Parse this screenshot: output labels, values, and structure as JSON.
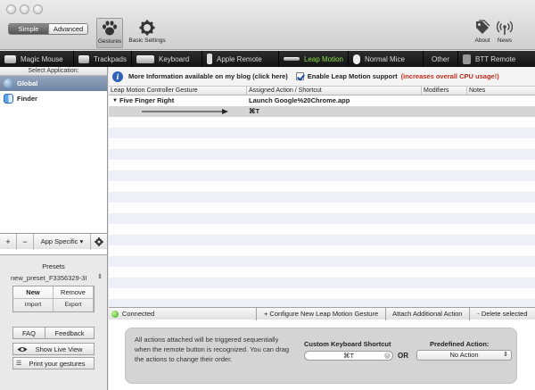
{
  "toolbar": {
    "mode_simple": "Simple",
    "mode_advanced": "Advanced",
    "gestures_label": "Gestures",
    "basic_settings_label": "Basic Settings",
    "about_label": "About",
    "news_label": "News"
  },
  "devices": [
    {
      "label": "Magic Mouse",
      "icon": "magic-mouse-icon"
    },
    {
      "label": "Trackpads",
      "icon": "trackpad-icon"
    },
    {
      "label": "Keyboard",
      "icon": "keyboard-icon"
    },
    {
      "label": "Apple Remote",
      "icon": "apple-remote-icon"
    },
    {
      "label": "Leap Motion",
      "icon": "leap-motion-icon",
      "active": true
    },
    {
      "label": "Normal Mice",
      "icon": "mouse-icon"
    },
    {
      "label": "Other",
      "icon": ""
    },
    {
      "label": "BTT Remote",
      "icon": "btt-remote-icon"
    }
  ],
  "sidebar": {
    "header": "Select Application:",
    "apps": [
      {
        "label": "Global",
        "icon": "globe-icon",
        "selected": true
      },
      {
        "label": "Finder",
        "icon": "finder-icon"
      }
    ],
    "add": "+",
    "remove": "−",
    "app_specific": "App Specific ▾",
    "settings_icon": "gear-icon"
  },
  "presets": {
    "label": "Presets",
    "current": "new_preset_F3356329-3I",
    "new": "New",
    "remove": "Remove",
    "import": "Import",
    "export": "Export",
    "faq": "FAQ",
    "feedback": "Feedback",
    "show_live_view": "Show Live View",
    "print_gestures": "Print your gestures"
  },
  "infobar": {
    "blog_link": "More Information available on my blog (click here)",
    "enable_label": "Enable Leap Motion support",
    "warning": "(increases overall CPU usage!)",
    "enabled": true
  },
  "table": {
    "columns": [
      "Leap Motion Controller Gesture",
      "Assigned Action / Shortcut",
      "Modifiers",
      "Notes"
    ],
    "rows": [
      {
        "gesture": "Five Finger Right",
        "action": "Launch Google%20Chrome.app",
        "modifiers": "",
        "notes": ""
      },
      {
        "gesture": "",
        "action": "⌘T",
        "modifiers": "",
        "notes": ""
      }
    ]
  },
  "bottombar": {
    "status": "Connected",
    "configure": "+ Configure New Leap Motion Gesture",
    "attach": "Attach Additional Action",
    "delete": "- Delete selected"
  },
  "panel": {
    "description": "All actions attached will be triggered sequentially when the remote button is recognized. You can drag the actions to change their order.",
    "shortcut_label": "Custom Keyboard Shortcut",
    "shortcut_value": "⌘T",
    "or": "OR",
    "predefined_label": "Predefined Action:",
    "predefined_value": "No Action"
  }
}
